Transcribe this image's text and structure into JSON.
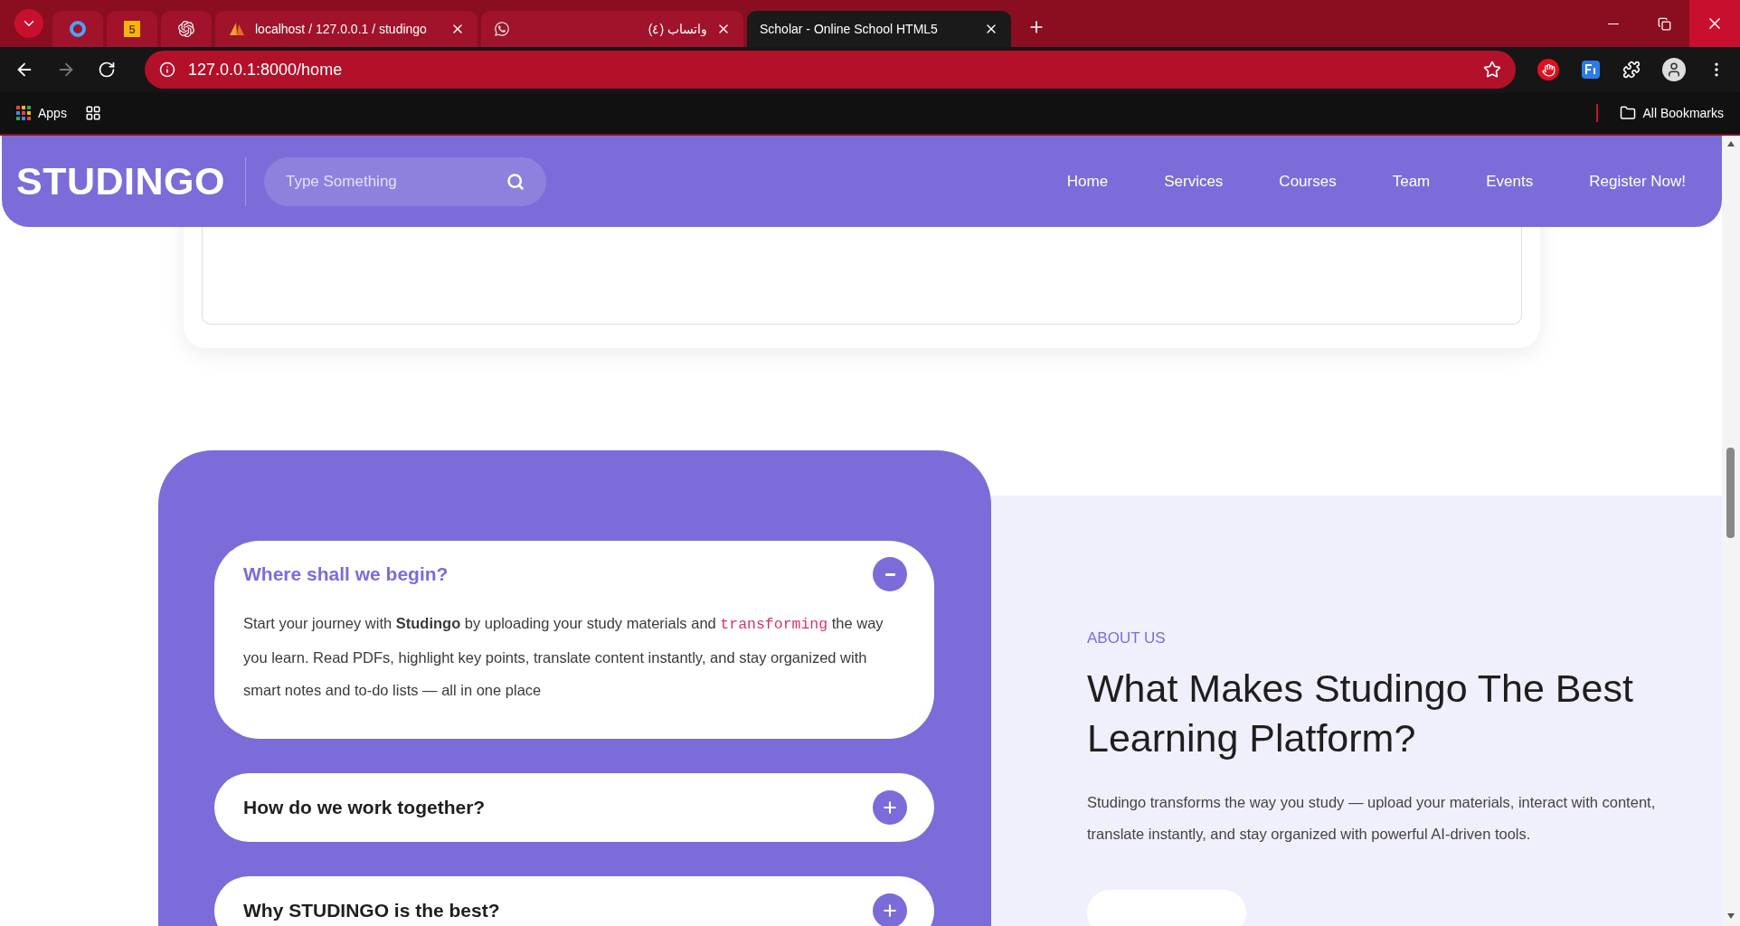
{
  "browser": {
    "pinned_tabs": [
      {
        "selected": false
      },
      {
        "selected": false,
        "badge": "5"
      },
      {
        "selected": false
      }
    ],
    "tabs": [
      {
        "title": "localhost / 127.0.0.1 / studingo",
        "selected": false
      },
      {
        "title": "واتساب (٤)",
        "selected": false
      },
      {
        "title": "Scholar - Online School HTML5",
        "selected": true
      }
    ],
    "address": "127.0.0.1:8000/home",
    "bookmarks": {
      "apps": "Apps",
      "all": "All Bookmarks"
    }
  },
  "header": {
    "logo": "STUDINGO",
    "search": {
      "placeholder": "Type Something"
    },
    "nav": [
      "Home",
      "Services",
      "Courses",
      "Team",
      "Events",
      "Register Now!"
    ]
  },
  "faq": [
    {
      "title": "Where shall we begin?",
      "expanded": true,
      "body": [
        {
          "kind": "text",
          "text": "Start your journey with **Studingo** by uploading your study materials and "
        },
        {
          "kind": "code",
          "text": "transforming"
        },
        {
          "kind": "text",
          "text": " the way you learn. Read PDFs, highlight key points, translate content instantly, and stay organized with smart notes and to-do lists — all in one place"
        }
      ]
    },
    {
      "title": "How do we work together?",
      "expanded": false
    },
    {
      "title": "Why STUDINGO is the best?",
      "expanded": false
    }
  ],
  "about": {
    "eyebrow": "ABOUT US",
    "heading": "What Makes Studingo The Best Learning Platform?",
    "text": "Studingo transforms the way you study — upload your materials, interact with content, translate instantly, and stay organized with powerful AI-driven tools."
  }
}
